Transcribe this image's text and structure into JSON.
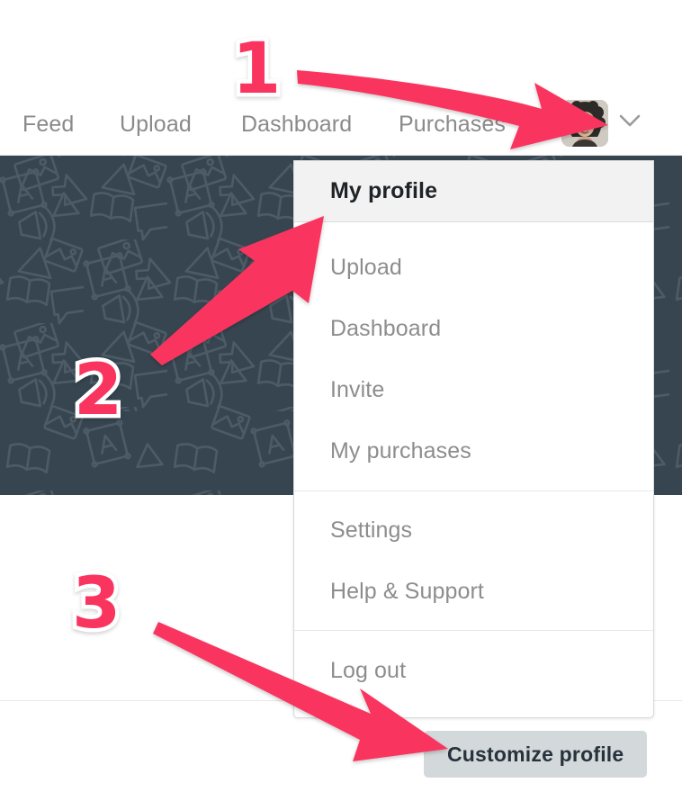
{
  "nav": {
    "items": [
      {
        "id": "feed",
        "label": "Feed"
      },
      {
        "id": "upload",
        "label": "Upload"
      },
      {
        "id": "dashboard",
        "label": "Dashboard"
      },
      {
        "id": "purchases",
        "label": "Purchases"
      }
    ],
    "avatar_alt": "user-avatar",
    "chevron": "chevron-down-icon"
  },
  "dropdown": {
    "selected": {
      "label": "My profile"
    },
    "group1": [
      {
        "label": "Upload"
      },
      {
        "label": "Dashboard"
      },
      {
        "label": "Invite"
      },
      {
        "label": "My purchases"
      }
    ],
    "group2": [
      {
        "label": "Settings"
      },
      {
        "label": "Help & Support"
      }
    ],
    "group3": [
      {
        "label": "Log out"
      }
    ]
  },
  "profile": {
    "customize_label": "Customize profile"
  },
  "annotations": {
    "markers": [
      {
        "id": "step-1",
        "label": "1"
      },
      {
        "id": "step-2",
        "label": "2"
      },
      {
        "id": "step-3",
        "label": "3"
      }
    ],
    "arrow_color": "#f9345f",
    "marker_color": "#f9345f",
    "marker_outline": "#ffffff"
  },
  "colors": {
    "banner_bg": "#374550",
    "banner_pattern": "#4d5b66",
    "nav_text": "#8a8a8a",
    "menu_text": "#8d8d8d",
    "menu_selected_bg": "#f2f2f2",
    "menu_selected_text": "#1f2326",
    "button_bg": "#d3d8da",
    "button_text": "#27323c",
    "page_bg": "#ffffff"
  }
}
